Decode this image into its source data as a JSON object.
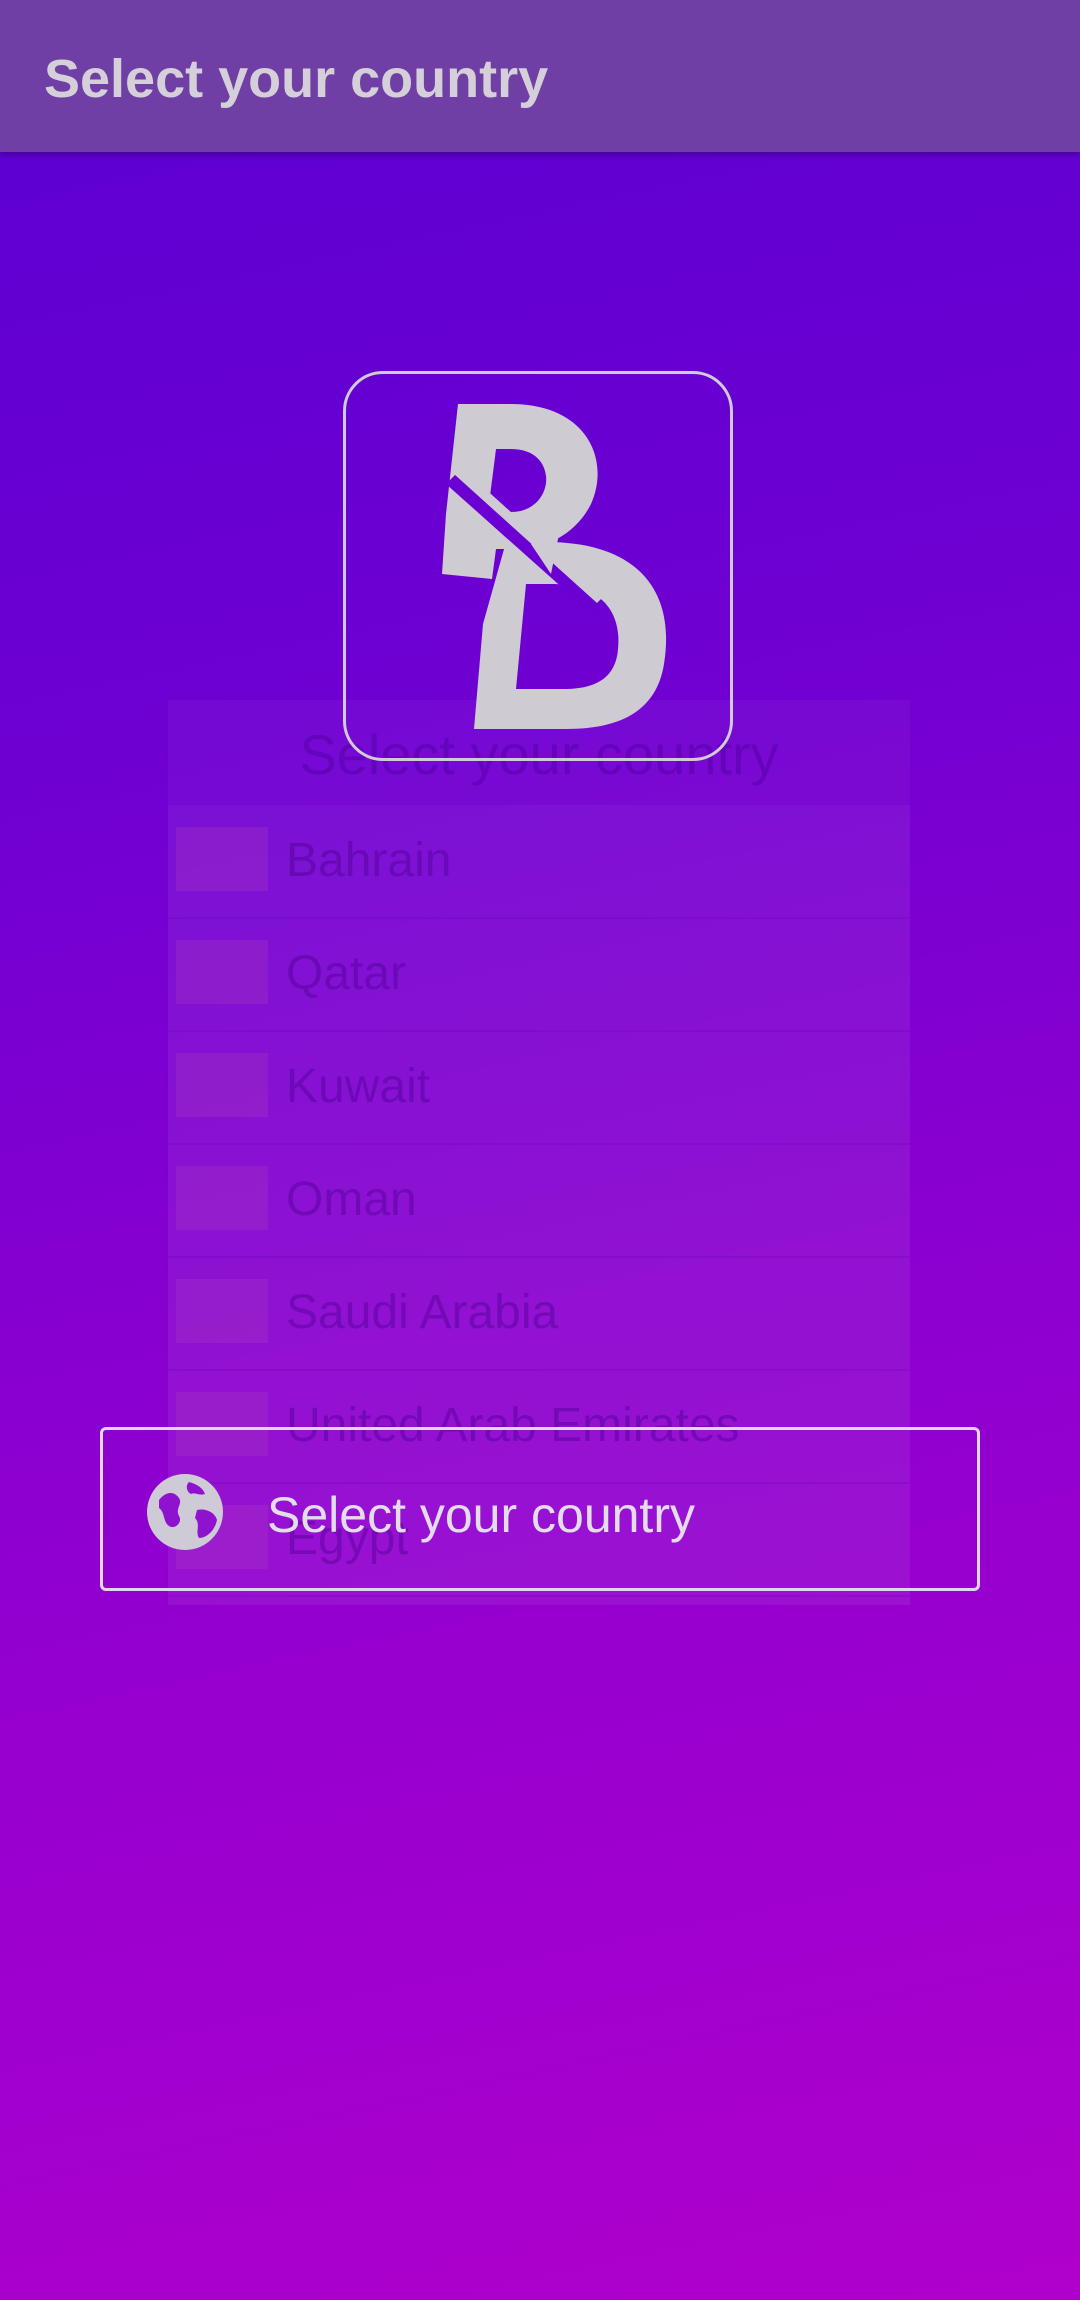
{
  "appbar": {
    "title": "Select your country"
  },
  "logo": {
    "icon": "bd-logo-icon"
  },
  "dialog": {
    "title": "Select your country",
    "countries": [
      {
        "name": "Bahrain"
      },
      {
        "name": "Qatar"
      },
      {
        "name": "Kuwait"
      },
      {
        "name": "Oman"
      },
      {
        "name": "Saudi Arabia"
      },
      {
        "name": "United Arab Emirates"
      },
      {
        "name": "Egypt"
      }
    ]
  },
  "select_button": {
    "label": "Select your country",
    "icon": "globe-icon"
  },
  "colors": {
    "appbar": "#703fa5",
    "gradient_top": "#5a00d2",
    "gradient_bottom": "#b000cc",
    "text": "#d4cfd8"
  }
}
